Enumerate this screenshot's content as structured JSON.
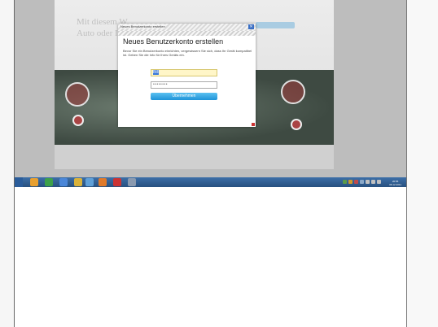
{
  "dialog": {
    "titlebar_text": "Neues Benutzerkonto erstellen",
    "heading": "Neues Benutzerkonto erstellen",
    "description": "Bevor Sie ein Benutzerkonto einrichten, vergewissern Sie sich, dass Ihr Gerät kompatibel ist. Geben Sie die Info für Ihres Geräts ein.",
    "name_value": "Bill",
    "password_placeholder": "••••••••",
    "submit_label": "Übernehmen",
    "close_glyph": "✕"
  },
  "background_page": {
    "hero_text_line1": "Mit diesem W",
    "hero_text_line2": "Auto oder Ihr"
  },
  "taskbar": {
    "clock_time": "20:55",
    "clock_date": "06.12.2011"
  },
  "colors": {
    "accent": "#1e93d8",
    "taskbar": "#27507f",
    "input_highlight": "#fff6c8"
  }
}
